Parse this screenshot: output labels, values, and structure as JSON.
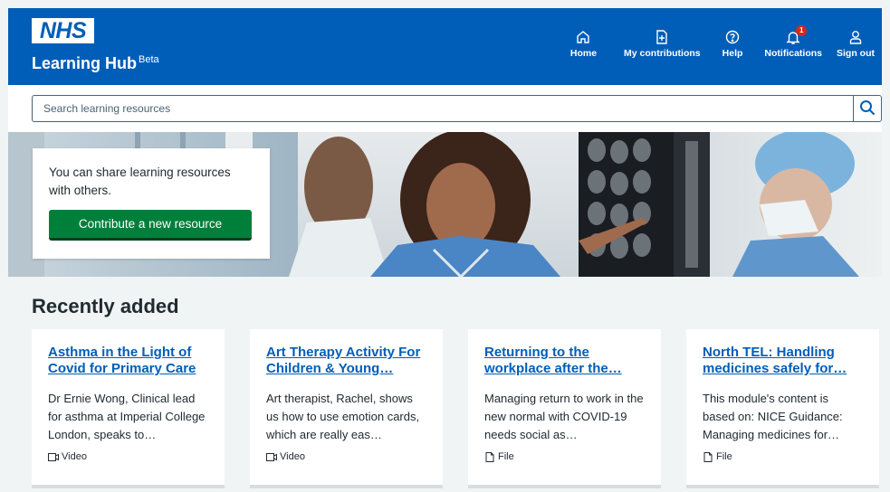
{
  "header": {
    "logo_text": "NHS",
    "brand_title": "Learning Hub",
    "brand_badge": "Beta",
    "nav": [
      {
        "label": "Home",
        "icon": "home-icon"
      },
      {
        "label": "My contributions",
        "icon": "contributions-icon"
      },
      {
        "label": "Help",
        "icon": "help-icon"
      },
      {
        "label": "Notifications",
        "icon": "bell-icon",
        "badge": "1"
      },
      {
        "label": "Sign out",
        "icon": "user-icon"
      }
    ]
  },
  "search": {
    "placeholder": "Search learning resources",
    "value": ""
  },
  "hero": {
    "text": "You can share learning resources with others.",
    "button_label": "Contribute a new resource"
  },
  "recent": {
    "title": "Recently added",
    "cards": [
      {
        "title": "Asthma in the Light of Covid for Primary Care",
        "description": "Dr Ernie Wong, Clinical lead for asthma at Imperial College London, speaks to…",
        "type": "Video"
      },
      {
        "title": "Art Therapy Activity For Children & Young…",
        "description": "Art therapist, Rachel, shows us how to use emotion cards, which are really eas…",
        "type": "Video"
      },
      {
        "title": "Returning to the workplace after the…",
        "description": "Managing return to work in the new normal with COVID-19 needs social as…",
        "type": "File"
      },
      {
        "title": "North TEL: Handling medicines safely for…",
        "description": "This module's content is based on: NICE Guidance: Managing medicines for…",
        "type": "File"
      }
    ]
  },
  "colors": {
    "brand_blue": "#005eb8",
    "button_green": "#007f3b",
    "page_bg": "#f0f4f5",
    "badge_red": "#d5281b"
  }
}
